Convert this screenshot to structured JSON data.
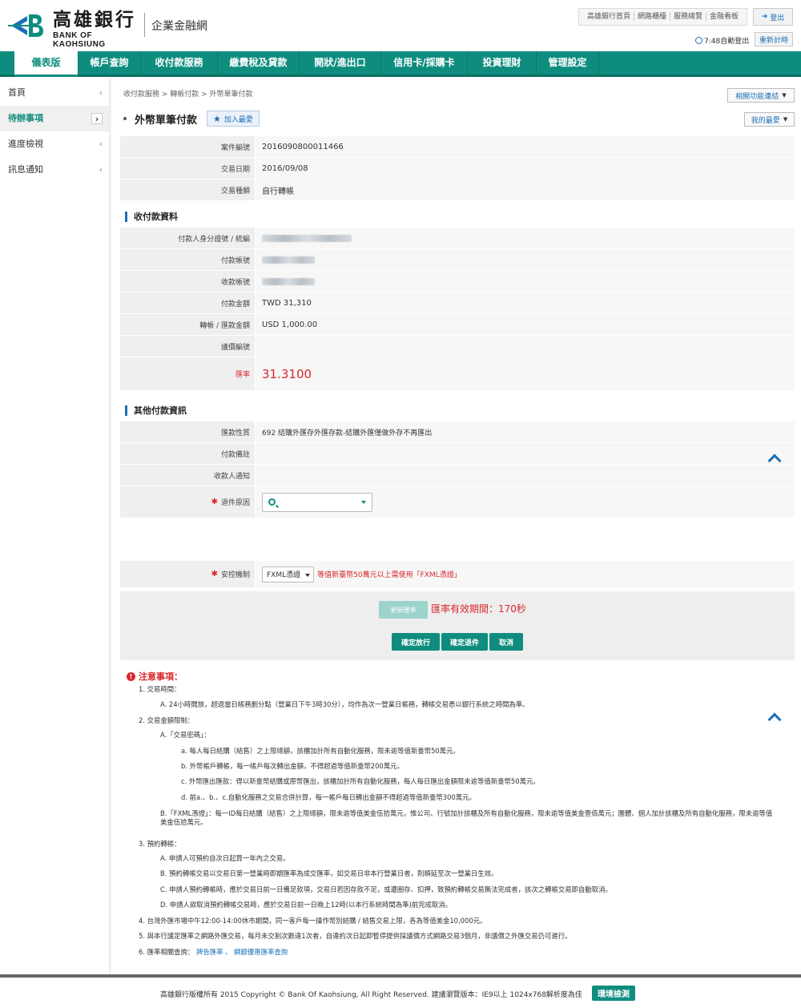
{
  "header": {
    "logo_zh": "高雄銀行",
    "logo_en": "BANK OF KAOHSIUNG",
    "site_name": "企業金融網",
    "top_links": [
      "高雄銀行首頁",
      "網路櫃檯",
      "服務總覽",
      "金融看板"
    ],
    "login_label": "登出",
    "timer_text": "7:48自動登出",
    "retime_label": "重新計時"
  },
  "nav": {
    "items": [
      "儀表版",
      "帳戶查詢",
      "收付款服務",
      "繳費稅及貸款",
      "開狀/進出口",
      "信用卡/採購卡",
      "投資理財",
      "管理設定"
    ]
  },
  "sidebar": {
    "items": [
      "首頁",
      "待辦事項",
      "進度檢視",
      "訊息通知"
    ]
  },
  "breadcrumb": "收付款服務 > 轉帳付款 > 外幣單筆付款",
  "related_button": "相關功能連結",
  "fav_button": "我的最愛",
  "page_title": "外幣單筆付款",
  "add_fav_label": "加入最愛",
  "basic": [
    {
      "label": "案件編號",
      "value": "2016090800011466"
    },
    {
      "label": "交易日期",
      "value": "2016/09/08"
    },
    {
      "label": "交易種類",
      "value": "自行轉帳"
    }
  ],
  "section1_title": "收付款資料",
  "payment": [
    {
      "label": "付款人身分證號 / 統編",
      "value": ""
    },
    {
      "label": "付款帳號",
      "value": ""
    },
    {
      "label": "收款帳號",
      "value": ""
    },
    {
      "label": "付款金額",
      "value": "TWD 31,310"
    },
    {
      "label": "轉帳 / 匯款金額",
      "value": "USD 1,000.00"
    },
    {
      "label": "議價編號",
      "value": ""
    },
    {
      "label": "匯率",
      "value": "31.3100"
    }
  ],
  "section2_title": "其他付款資訊",
  "other": [
    {
      "label": "匯款性質",
      "value": "692 結購外匯存外匯存款-結購外匯僅做外存不再匯出"
    },
    {
      "label": "付款備註",
      "value": ""
    },
    {
      "label": "收款人通知",
      "value": ""
    }
  ],
  "return_reason_label": "退件原因",
  "auth_label": "安控機制",
  "auth_value": "FXML憑證",
  "auth_warning": "等值新臺幣50萬元以上需使用「FXML憑證」",
  "rate_button": "更新匯率",
  "rate_valid": "匯率有效期間：170秒",
  "buttons": {
    "approve": "確定放行",
    "reject": "確定退件",
    "cancel": "取消"
  },
  "notice": {
    "title": "注意事項：",
    "lines": [
      "1. 交易時間：",
      "A. 24小時開放，超過當日帳務劃分點（營業日下午3時30分），均作為次一營業日帳務，轉帳交易悉以銀行系統之時間為準。",
      "2. 交易金額限制：",
      "A.「交易密碼」：",
      "a. 每人每日結購（結售）之上限總額，該櫃加計所有自動化服務，限未逾等值新臺幣50萬元。",
      "b. 外幣帳戶轉帳，每一帳戶每次轉出金額，不得超過等值新臺幣200萬元。",
      "c. 外幣匯出匯款：得以新臺幣結購或原幣匯出，該櫃加計所有自動化服務，每人每日匯出金額限未逾等值新臺幣50萬元。",
      "d. 前a.、b.、c.自動化服務之交易合併計算，每一帳戶每日轉出金額不得超過等值新臺幣300萬元。",
      "B.「FXML憑證」：每一ID每日結購（結售）之上限總額，限未逾等值美金伍拾萬元，惟公司、行號加計該櫃及所有自動化服務，限未逾等值美金壹佰萬元；團體、個人加計該櫃及所有自動化服務，限未逾等值美金伍拾萬元。",
      "3. 預約轉帳：",
      "A. 申請人可預約自次日起算一年內之交易。",
      "B. 預約轉帳交易以交易日第一營業時即期匯率為成交匯率，如交易日非本行營業日者，則順延至次一營業日生效。",
      "C. 申請人預約轉帳時，應於交易日前一日備足款項，交易日若因存款不足，或遭圈存、扣押，致預約轉帳交易無法完成者，該次之轉帳交易即自動取消。",
      "D. 申請人欲取消預約轉帳交易時，應於交易日前一日晚上12時(以本行系統時間為準)前完成取消。",
      "4. 台灣外匯市場中午12:00-14:00休市期間，同一客戶每一操作幣別結購 / 結售交易上限，各為等值美金10,000元。",
      "5. 與本行議定匯率之網路外匯交易，每月未交割次數達1次者，自違約次日起即暫停提供採議價方式網路交易3個月，非議價之外匯交易仍可進行。",
      "6. 匯率相關查詢："
    ],
    "links": [
      "牌告匯率",
      "網銀優惠匯率查詢"
    ]
  },
  "footer": {
    "text": "高雄銀行版權所有 2015 Copyright © Bank Of Kaohsiung, All Right Reserved. 建議瀏覽版本：IE9以上 1024x768解析度為佳",
    "env_button": "環境檢測"
  },
  "colors": {
    "brand_green": "#0e8d7f",
    "link_blue": "#1a6fb5",
    "alert_red": "#d9262b"
  }
}
